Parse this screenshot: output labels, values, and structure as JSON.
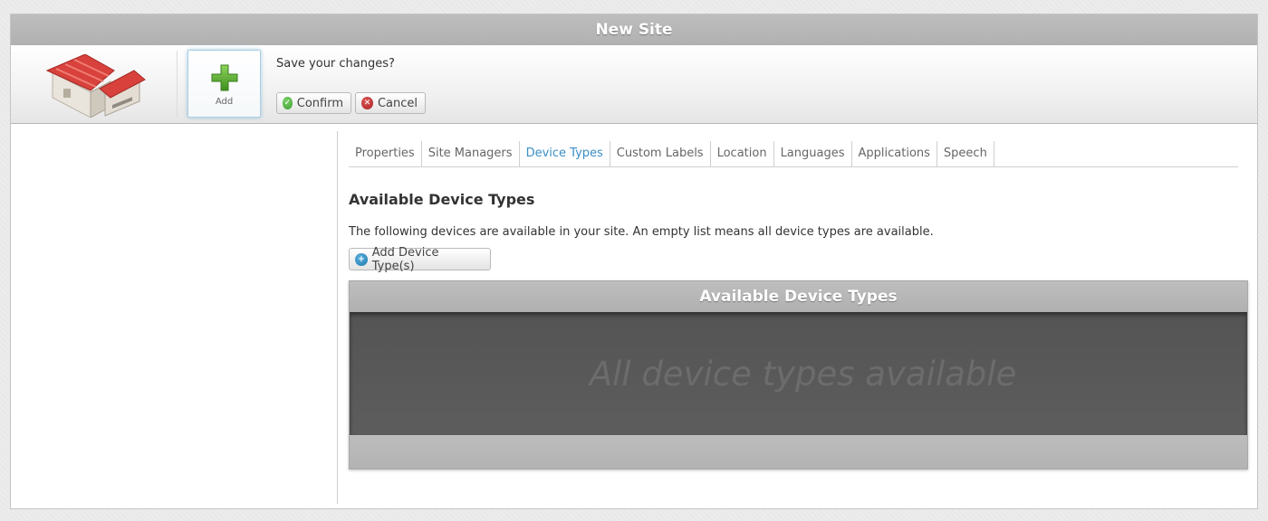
{
  "window": {
    "title": "New Site"
  },
  "toolbar": {
    "add_label": "Add",
    "save_question": "Save your changes?",
    "confirm_label": "Confirm",
    "cancel_label": "Cancel"
  },
  "tabs": [
    {
      "label": "Properties",
      "active": false
    },
    {
      "label": "Site Managers",
      "active": false
    },
    {
      "label": "Device Types",
      "active": true
    },
    {
      "label": "Custom Labels",
      "active": false
    },
    {
      "label": "Location",
      "active": false
    },
    {
      "label": "Languages",
      "active": false
    },
    {
      "label": "Applications",
      "active": false
    },
    {
      "label": "Speech",
      "active": false
    }
  ],
  "section": {
    "heading": "Available Device Types",
    "description": "The following devices are available in your site. An empty list means all device types are available.",
    "add_button_label": "Add Device Type(s)"
  },
  "panel": {
    "title": "Available Device Types",
    "empty_text": "All device types available"
  },
  "icons": {
    "logo": "site-building-icon",
    "add": "green-plus-icon",
    "confirm": "check-circle-icon",
    "cancel": "x-circle-icon",
    "add_device": "blue-plus-circle-icon"
  },
  "colors": {
    "active_tab": "#3b8ec6",
    "header_gray": "#b8b8b8",
    "panel_body": "#595959"
  }
}
